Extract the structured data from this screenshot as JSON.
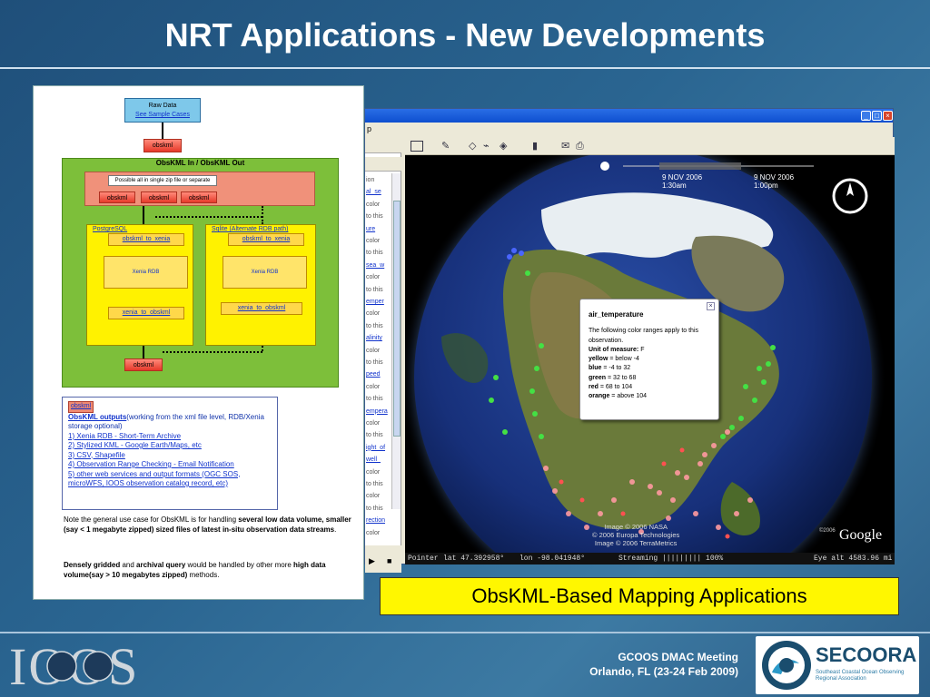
{
  "slide": {
    "title": "NRT Applications - New Developments",
    "caption": "ObsKML-Based Mapping Applications",
    "footer": {
      "meeting_line1": "GCOOS DMAC Meeting",
      "meeting_line2": "Orlando, FL (23-24 Feb 2009)",
      "ioos_logo_text": "IOOS",
      "secoora_name": "SECOORA",
      "secoora_sub1": "Southeast Coastal Ocean Observing",
      "secoora_sub2": "Regional Association"
    }
  },
  "flowchart": {
    "raw_data": "Raw Data",
    "see_cases": "See Sample Cases",
    "obskml": "obskml",
    "green_title": "ObsKML In / ObsKML Out",
    "zip_label": "Possible all in single zip file or separate",
    "postgres": "PostgreSQL",
    "sqlite": "Sqlite (Alternate RDB path)",
    "obskml_to_xenia": "obskml_to_xenia",
    "xenia_rdb": "Xenia RDB",
    "xenia_to_obskml": "xenia_to_obskml",
    "outputs": {
      "tag": "obskml",
      "heading_link": "ObsKML outputs",
      "heading_rest": "(working from the xml file level, RDB/Xenia storage optional)",
      "items": [
        "1) Xenia RDB - Short-Term Archive",
        "2) Stylized KML - Google Earth/Maps, etc",
        "3) CSV, Shapefile",
        "4) Observation Range Checking - Email Notification",
        "5) other web services and output formats (OGC SOS, microWFS, IOOS observation catalog record, etc)"
      ]
    },
    "note1_a": "Note the general use case for ObsKML is for handling ",
    "note1_b": "several low data volume, smaller (say < 1 megabyte zipped) sized files of latest in-situ observation data streams",
    "note1_c": ".",
    "note2_a": "Densely gridded",
    "note2_b": " and ",
    "note2_c": "archival query",
    "note2_d": " would be handled by other more ",
    "note2_e": "high data volume(say > 10 megabytes zipped)",
    "note2_f": " methods."
  },
  "earth": {
    "menu_fragment": "p",
    "sidebar_lines": [
      "ion",
      "al_se",
      "color",
      "to this",
      "ure",
      "color",
      "to this",
      "sea_w",
      "color",
      "to this",
      "emper",
      "color",
      "to this",
      "alinity",
      "color",
      "to this",
      "peed",
      "color",
      "to this",
      "empera",
      "color",
      "to this",
      "ight_of",
      "well_",
      "color",
      "to this",
      "color",
      "to this",
      "rection",
      "color"
    ],
    "popup": {
      "title": "air_temperature",
      "intro": "The following color ranges apply to this observation.",
      "unit_label": "Unit of measure:",
      "unit_value": "F",
      "ranges": [
        {
          "color": "yellow",
          "range": "below -4"
        },
        {
          "color": "blue",
          "range": "-4 to 32"
        },
        {
          "color": "green",
          "range": "32 to 68"
        },
        {
          "color": "red",
          "range": "68 to 104"
        },
        {
          "color": "orange",
          "range": "above 104"
        }
      ],
      "range_sep": " = "
    },
    "time_left": "9 NOV 2006",
    "time_left2": "1:30am",
    "time_right": "9 NOV 2006",
    "time_right2": "1:00pm",
    "credits": [
      "Image © 2006 NASA",
      "© 2006 Europa Technologies",
      "Image © 2006 TerraMetrics"
    ],
    "google_small": "©2006",
    "google": "Google",
    "status": {
      "pointer": "Pointer",
      "lat": "lat  47.392958°",
      "lon": "lon  -98.041948°",
      "streaming": "Streaming  |||||||||  100%",
      "eye": "Eye alt   4583.96 mi"
    }
  }
}
